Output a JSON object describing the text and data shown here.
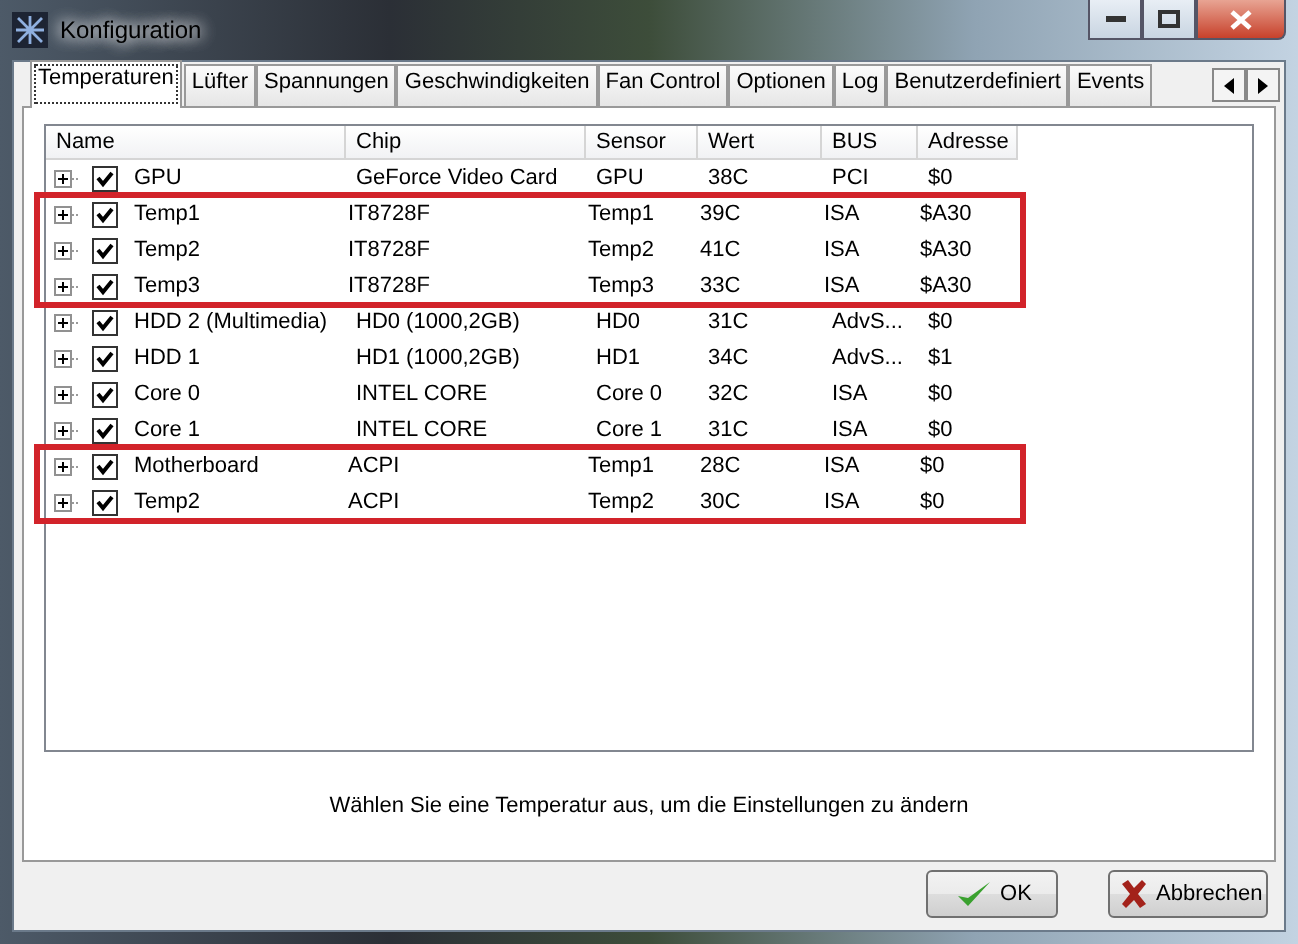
{
  "window": {
    "title": "Konfiguration"
  },
  "tabs": [
    {
      "label": "Temperaturen",
      "selected": true
    },
    {
      "label": "Lüfter",
      "selected": false
    },
    {
      "label": "Spannungen",
      "selected": false
    },
    {
      "label": "Geschwindigkeiten",
      "selected": false
    },
    {
      "label": "Fan Control",
      "selected": false
    },
    {
      "label": "Optionen",
      "selected": false
    },
    {
      "label": "Log",
      "selected": false
    },
    {
      "label": "Benutzerdefiniert",
      "selected": false
    },
    {
      "label": "Events",
      "selected": false
    }
  ],
  "table": {
    "columns": [
      "Name",
      "Chip",
      "Sensor",
      "Wert",
      "BUS",
      "Adresse"
    ],
    "row_groups": [
      {
        "highlighted": false,
        "rows": [
          {
            "checked": true,
            "cells": [
              "GPU",
              "GeForce Video Card",
              "GPU",
              "38C",
              "PCI",
              "$0"
            ]
          }
        ]
      },
      {
        "highlighted": true,
        "rows": [
          {
            "checked": true,
            "cells": [
              "Temp1",
              "IT8728F",
              "Temp1",
              "39C",
              "ISA",
              "$A30"
            ]
          },
          {
            "checked": true,
            "cells": [
              "Temp2",
              "IT8728F",
              "Temp2",
              "41C",
              "ISA",
              "$A30"
            ]
          },
          {
            "checked": true,
            "cells": [
              "Temp3",
              "IT8728F",
              "Temp3",
              "33C",
              "ISA",
              "$A30"
            ]
          }
        ]
      },
      {
        "highlighted": false,
        "rows": [
          {
            "checked": true,
            "cells": [
              "HDD 2 (Multimedia)",
              "HD0 (1000,2GB)",
              "HD0",
              "31C",
              "AdvS...",
              "$0"
            ]
          },
          {
            "checked": true,
            "cells": [
              "HDD 1",
              "HD1 (1000,2GB)",
              "HD1",
              "34C",
              "AdvS...",
              "$1"
            ]
          },
          {
            "checked": true,
            "cells": [
              "Core 0",
              "INTEL CORE",
              "Core 0",
              "32C",
              "ISA",
              "$0"
            ]
          },
          {
            "checked": true,
            "cells": [
              "Core 1",
              "INTEL CORE",
              "Core 1",
              "31C",
              "ISA",
              "$0"
            ]
          }
        ]
      },
      {
        "highlighted": true,
        "rows": [
          {
            "checked": true,
            "cells": [
              "Motherboard",
              "ACPI",
              "Temp1",
              "28C",
              "ISA",
              "$0"
            ]
          },
          {
            "checked": true,
            "cells": [
              "Temp2",
              "ACPI",
              "Temp2",
              "30C",
              "ISA",
              "$0"
            ]
          }
        ]
      }
    ]
  },
  "hint": "Wählen Sie eine Temperatur aus, um die Einstellungen zu ändern",
  "buttons": [
    {
      "kind": "ok",
      "label": "OK"
    },
    {
      "kind": "cancel",
      "label": "Abbrechen"
    }
  ]
}
